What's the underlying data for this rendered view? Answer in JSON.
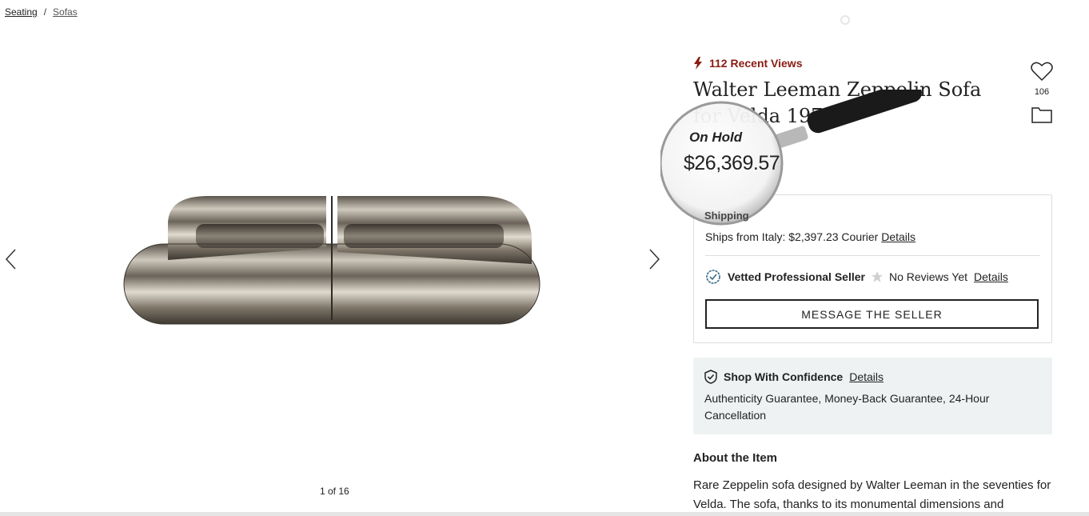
{
  "breadcrumb": {
    "items": [
      "Seating",
      "Sofas"
    ],
    "separator": "/"
  },
  "gallery": {
    "counter": "1 of 16",
    "prev_icon": "chevron-left-icon",
    "next_icon": "chevron-right-icon"
  },
  "product": {
    "recent_views": "112 Recent Views",
    "title": "Walter Leeman Zeppelin Sofa for Velda 1970s",
    "favorites_count": "106",
    "status": "On Hold",
    "price": "$26,369.57",
    "status_line": "Shipping"
  },
  "shipping": {
    "text": "Ships from Italy: $2,397.23 Courier",
    "details_label": "Details"
  },
  "seller": {
    "badge": "Vetted Professional Seller",
    "reviews": "No Reviews Yet",
    "details_label": "Details"
  },
  "message_button": "MESSAGE THE SELLER",
  "confidence": {
    "title": "Shop With Confidence",
    "details_label": "Details",
    "text": "Authenticity Guarantee, Money-Back Guarantee, 24-Hour Cancellation"
  },
  "about": {
    "title": "About the Item",
    "text": "Rare Zeppelin sofa designed by Walter Leeman in the seventies for Velda. The sofa, thanks to its monumental dimensions and"
  },
  "colors": {
    "accent": "#8a1c12",
    "panel": "#eef2f2"
  }
}
